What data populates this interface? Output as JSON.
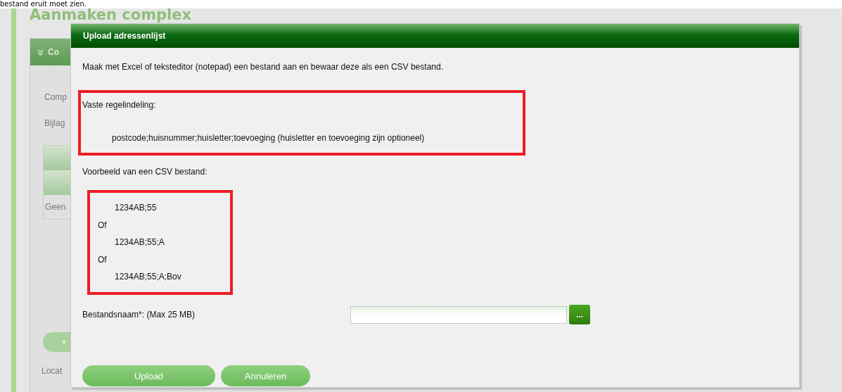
{
  "page_caption": "bestand eruit moet zien.",
  "page_title": "Aanmaken complex",
  "panel": {
    "header": "Co",
    "fields": [
      "Comp",
      "Bijlag"
    ],
    "empty_text": "Geen",
    "add_button": "+",
    "footer_label": "Locat"
  },
  "dialog": {
    "title": "Upload adressenlijst",
    "intro": "Maak met Excel of teksteditor (notepad) een bestand aan en bewaar deze als een CSV bestand.",
    "format": {
      "label": "Vaste regelindeling:",
      "pattern": "postcode;huisnummer;huisletter;toevoeging (huisletter en toevoeging zijn optioneel)"
    },
    "example": {
      "label": "Voorbeeld van een CSV bestand:",
      "lines": [
        {
          "kind": "sample",
          "text": "1234AB;55"
        },
        {
          "kind": "separator",
          "text": "Of"
        },
        {
          "kind": "sample",
          "text": "1234AB;55;A"
        },
        {
          "kind": "separator",
          "text": "Of"
        },
        {
          "kind": "sample",
          "text": "1234AB;55;A;Bov"
        }
      ]
    },
    "file": {
      "label": "Bestandsnaam*: (Max 25 MB)",
      "browse": "..."
    },
    "buttons": [
      "Upload",
      "Annuleren"
    ]
  }
}
